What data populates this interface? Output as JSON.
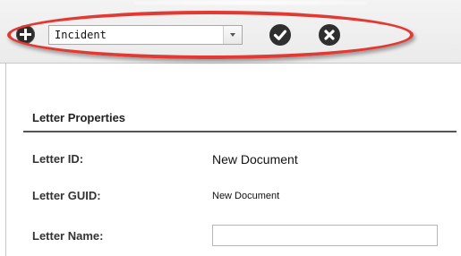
{
  "toolbar": {
    "add_icon": "plus-circle-icon",
    "type_select": {
      "value": "Incident"
    },
    "confirm_icon": "check-circle-icon",
    "cancel_icon": "x-circle-icon",
    "highlight_color": "#e23a33"
  },
  "letter_properties": {
    "title": "Letter Properties",
    "fields": [
      {
        "label": "Letter ID:",
        "value": "New Document"
      },
      {
        "label": "Letter GUID:",
        "value": "New Document"
      },
      {
        "label": "Letter Name:",
        "value": ""
      }
    ]
  }
}
